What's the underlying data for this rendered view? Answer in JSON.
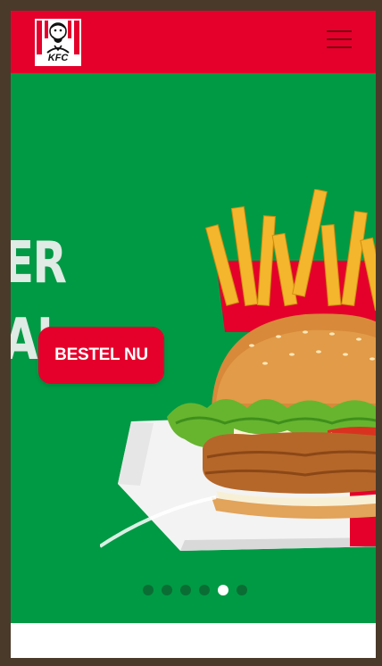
{
  "header": {
    "logo_text": "KFC",
    "menu_icon": "hamburger-menu-icon"
  },
  "hero": {
    "partial_text_lines": [
      "ER",
      "AL"
    ],
    "cta_label": "BESTEL NU",
    "carousel": {
      "count": 6,
      "active_index": 4
    }
  },
  "colors": {
    "brand_red": "#e4002b",
    "hero_green": "#009a44",
    "dot_inactive": "#0a6e34",
    "dot_active": "#ffffff"
  }
}
